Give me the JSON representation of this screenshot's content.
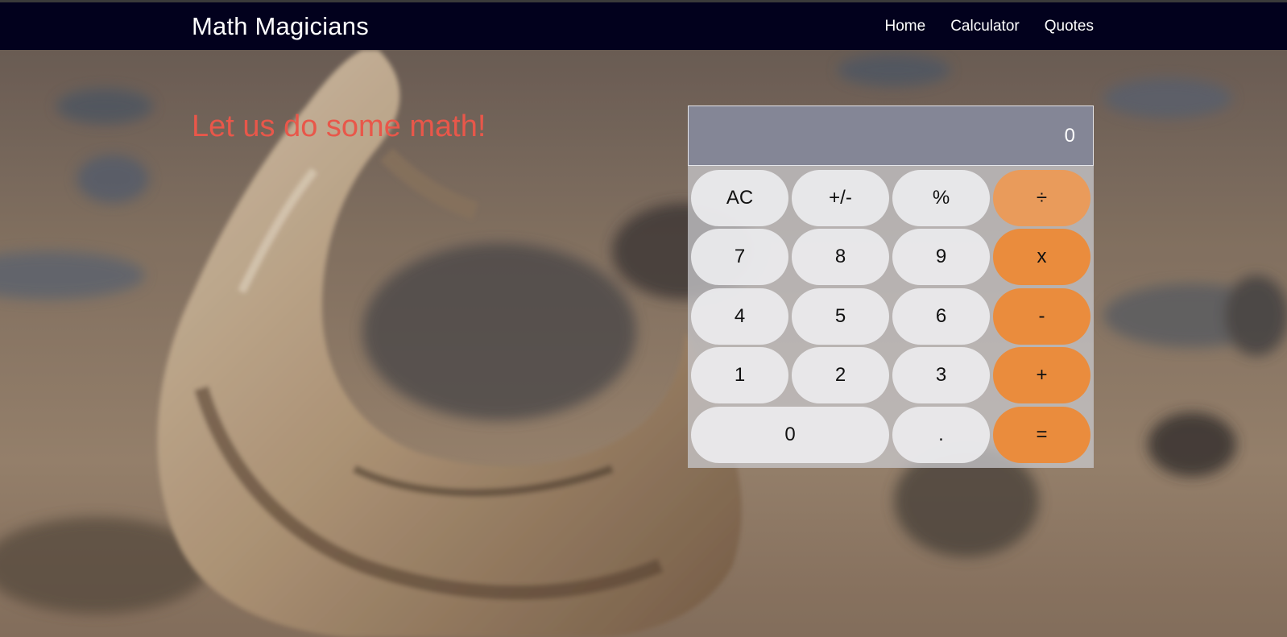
{
  "navbar": {
    "brand": "Math Magicians",
    "links": [
      {
        "label": "Home"
      },
      {
        "label": "Calculator"
      },
      {
        "label": "Quotes"
      }
    ]
  },
  "hero": {
    "headline": "Let us do some math!"
  },
  "calculator": {
    "display": "0",
    "buttons": {
      "ac": "AC",
      "sign": "+/-",
      "percent": "%",
      "divide": "÷",
      "seven": "7",
      "eight": "8",
      "nine": "9",
      "multiply": "x",
      "four": "4",
      "five": "5",
      "six": "6",
      "subtract": "-",
      "one": "1",
      "two": "2",
      "three": "3",
      "add": "+",
      "zero": "0",
      "decimal": ".",
      "equals": "="
    }
  },
  "colors": {
    "navbar_bg": "#02011d",
    "headline": "#e8574a",
    "operator": "#ea8c3d",
    "display_bg": "#848696"
  }
}
